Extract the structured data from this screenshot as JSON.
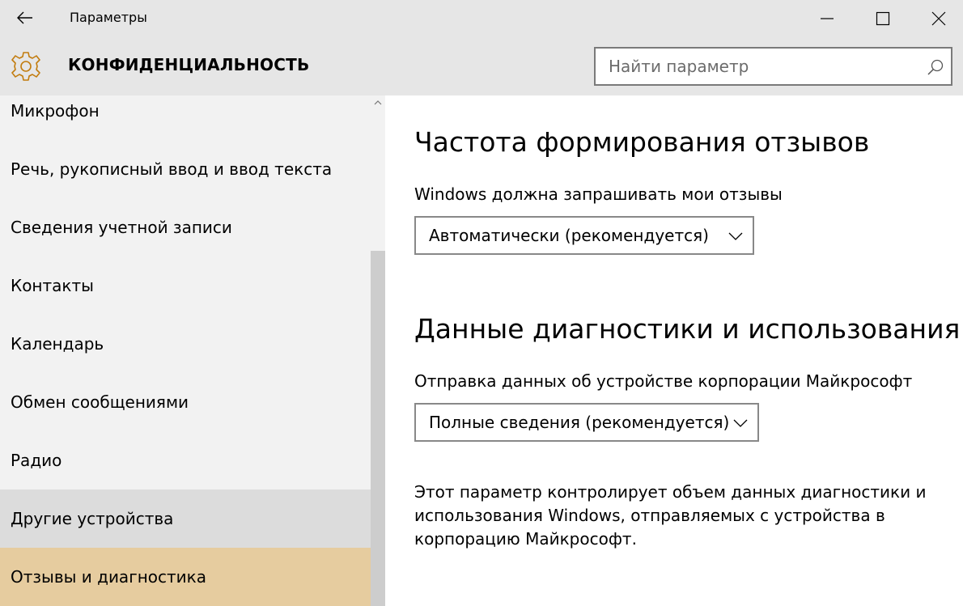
{
  "window": {
    "app_title": "Параметры"
  },
  "header": {
    "section_title": "КОНФИДЕНЦИАЛЬНОСТЬ",
    "search_placeholder": "Найти параметр"
  },
  "sidebar": {
    "items": [
      {
        "label": "Микрофон",
        "state": "normal"
      },
      {
        "label": "Речь, рукописный ввод и ввод текста",
        "state": "normal"
      },
      {
        "label": "Сведения учетной записи",
        "state": "normal"
      },
      {
        "label": "Контакты",
        "state": "normal"
      },
      {
        "label": "Календарь",
        "state": "normal"
      },
      {
        "label": "Обмен сообщениями",
        "state": "normal"
      },
      {
        "label": "Радио",
        "state": "normal"
      },
      {
        "label": "Другие устройства",
        "state": "hover"
      },
      {
        "label": "Отзывы и диагностика",
        "state": "selected"
      }
    ]
  },
  "main": {
    "feedback_frequency": {
      "heading": "Частота формирования отзывов",
      "label": "Windows должна запрашивать мои отзывы",
      "selected_value": "Автоматически (рекомендуется)"
    },
    "diagnostics": {
      "heading": "Данные диагностики и использования",
      "label": "Отправка данных об устройстве корпорации Майкрософт",
      "selected_value": "Полные сведения (рекомендуется)",
      "description": "Этот параметр контролирует объем данных диагностики и использования Windows, отправляемых с устройства в корпорацию Майкрософт."
    }
  },
  "colors": {
    "accent": "#c27c0e",
    "selected_item_bg": "#e6cc9f",
    "hover_item_bg": "#dcdcdc",
    "sidebar_bg": "#f2f2f2",
    "header_bg": "#e6e6e6"
  },
  "icons": {
    "back": "back-arrow-icon",
    "minimize": "minimize-icon",
    "maximize": "maximize-icon",
    "close": "close-icon",
    "settings": "gear-icon",
    "search": "search-icon",
    "dropdown": "chevron-down-icon"
  }
}
